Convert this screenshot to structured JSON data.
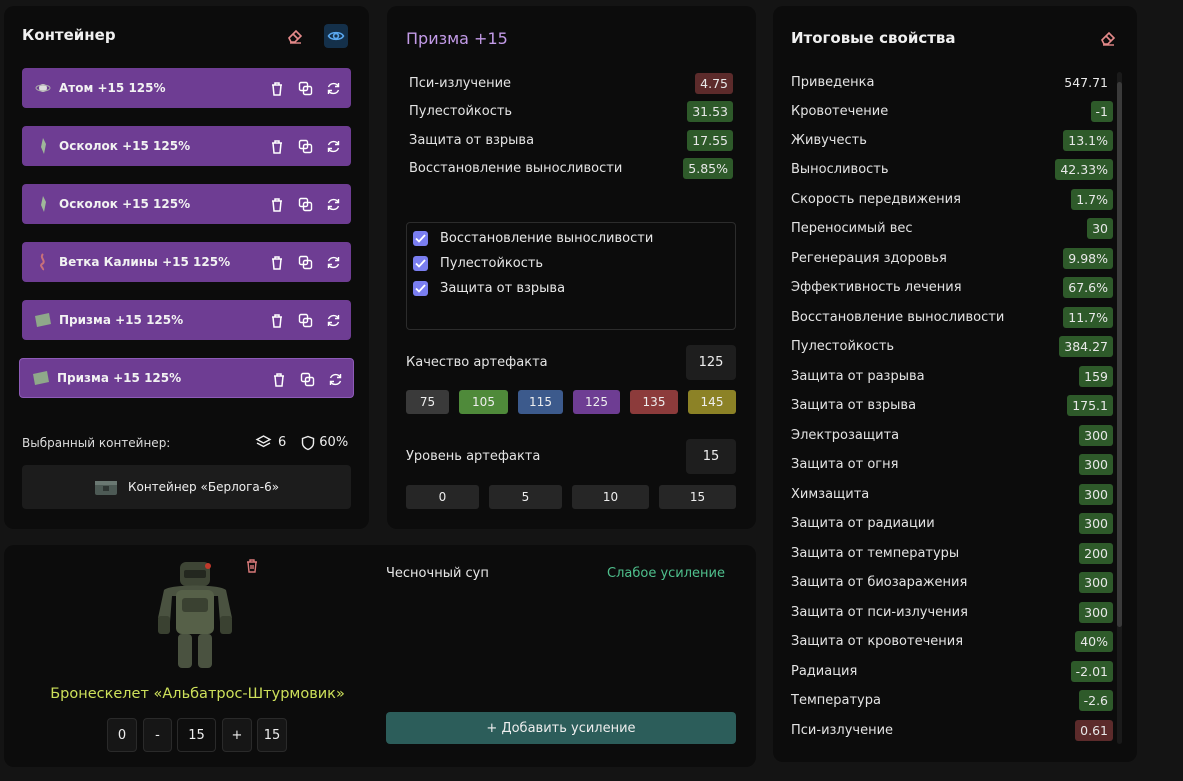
{
  "container": {
    "title": "Контейнер",
    "artifacts": [
      {
        "name": "Атом",
        "level": "+15",
        "quality": "125%"
      },
      {
        "name": "Осколок",
        "level": "+15",
        "quality": "125%"
      },
      {
        "name": "Осколок",
        "level": "+15",
        "quality": "125%"
      },
      {
        "name": "Ветка Калины",
        "level": "+15",
        "quality": "125%"
      },
      {
        "name": "Призма",
        "level": "+15",
        "quality": "125%"
      },
      {
        "name": "Призма",
        "level": "+15",
        "quality": "125%"
      }
    ],
    "selected_label": "Выбранный контейнер:",
    "slots": "6",
    "protection": "60%",
    "container_name": "Контейнер «Берлога-6»"
  },
  "artifact": {
    "title": "Призма +15",
    "stats": [
      {
        "label": "Пси-излучение",
        "value": "4.75",
        "tone": "red"
      },
      {
        "label": "Пулестойкость",
        "value": "31.53",
        "tone": "green"
      },
      {
        "label": "Защита от взрыва",
        "value": "17.55",
        "tone": "green"
      },
      {
        "label": "Восстановление выносливости",
        "value": "5.85%",
        "tone": "green"
      }
    ],
    "checks": [
      "Восстановление выносливости",
      "Пулестойкость",
      "Защита от взрыва"
    ],
    "quality_label": "Качество артефакта",
    "quality_value": "125",
    "quality_options": [
      "75",
      "105",
      "115",
      "125",
      "135",
      "145"
    ],
    "quality_colors": [
      "#3a3a3a",
      "#4f8a3a",
      "#3c5a8c",
      "#6e3d93",
      "#8c3b3b",
      "#8c8226"
    ],
    "level_label": "Уровень артефакта",
    "level_value": "15",
    "level_options": [
      "0",
      "5",
      "10",
      "15"
    ]
  },
  "armor": {
    "name": "Бронескелет «Альбатрос-Штурмовик»",
    "min": "0",
    "minus": "-",
    "value": "15",
    "plus": "+",
    "max": "15"
  },
  "boosts": {
    "item": "Чесночный суп",
    "effect": "Слабое усиление",
    "add_label": "+ Добавить усиление"
  },
  "final": {
    "title": "Итоговые свойства",
    "props": [
      {
        "label": "Приведенка",
        "value": "547.71",
        "tone": "plain"
      },
      {
        "label": "Кровотечение",
        "value": "-1",
        "tone": "green"
      },
      {
        "label": "Живучесть",
        "value": "13.1%",
        "tone": "green"
      },
      {
        "label": "Выносливость",
        "value": "42.33%",
        "tone": "green"
      },
      {
        "label": "Скорость передвижения",
        "value": "1.7%",
        "tone": "green"
      },
      {
        "label": "Переносимый вес",
        "value": "30",
        "tone": "green"
      },
      {
        "label": "Регенерация здоровья",
        "value": "9.98%",
        "tone": "green"
      },
      {
        "label": "Эффективность лечения",
        "value": "67.6%",
        "tone": "green"
      },
      {
        "label": "Восстановление выносливости",
        "value": "11.7%",
        "tone": "green"
      },
      {
        "label": "Пулестойкость",
        "value": "384.27",
        "tone": "green"
      },
      {
        "label": "Защита от разрыва",
        "value": "159",
        "tone": "green"
      },
      {
        "label": "Защита от взрыва",
        "value": "175.1",
        "tone": "green"
      },
      {
        "label": "Электрозащита",
        "value": "300",
        "tone": "green"
      },
      {
        "label": "Защита от огня",
        "value": "300",
        "tone": "green"
      },
      {
        "label": "Химзащита",
        "value": "300",
        "tone": "green"
      },
      {
        "label": "Защита от радиации",
        "value": "300",
        "tone": "green"
      },
      {
        "label": "Защита от температуры",
        "value": "200",
        "tone": "green"
      },
      {
        "label": "Защита от биозаражения",
        "value": "300",
        "tone": "green"
      },
      {
        "label": "Защита от пси-излучения",
        "value": "300",
        "tone": "green"
      },
      {
        "label": "Защита от кровотечения",
        "value": "40%",
        "tone": "green"
      },
      {
        "label": "Радиация",
        "value": "-2.01",
        "tone": "green"
      },
      {
        "label": "Температура",
        "value": "-2.6",
        "tone": "green"
      },
      {
        "label": "Пси-излучение",
        "value": "0.61",
        "tone": "red"
      }
    ]
  },
  "colors": {
    "accent_violet": "#c39be8",
    "boost_green": "#4fc08d",
    "armor_name": "#cde05a",
    "add_button": "#2c5d5a"
  },
  "icons": [
    "eraser-icon",
    "eye-icon",
    "trash-icon",
    "copy-icon",
    "refresh-icon",
    "layers-icon",
    "shield-icon",
    "crate-icon"
  ]
}
